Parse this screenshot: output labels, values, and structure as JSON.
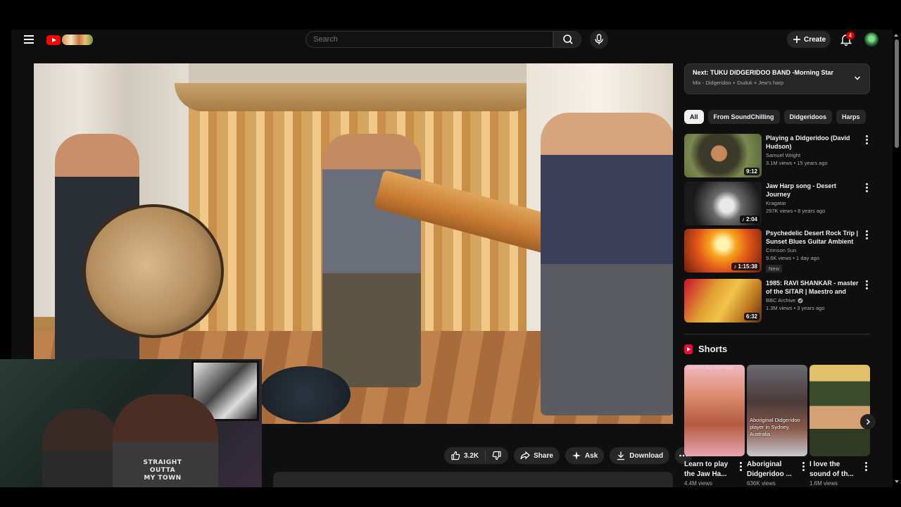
{
  "masthead": {
    "search_placeholder": "Search",
    "create_label": "Create",
    "notification_count": "4"
  },
  "player": {
    "next_title": "Next: TUKU DIDGERIDOO BAND -Morning Star",
    "next_subtitle": "Mix - Didgeridoo + Duduk + Jew's harp"
  },
  "actions": {
    "like_count": "3.2K",
    "share_label": "Share",
    "ask_label": "Ask",
    "download_label": "Download"
  },
  "webcam": {
    "shirt_lines": [
      "STRAIGHT",
      "OUTTA",
      "MY TOWN"
    ]
  },
  "chips": [
    "All",
    "From SoundChilling",
    "Didgeridoos",
    "Harps"
  ],
  "recommendations": [
    {
      "title": "Playing a Didgeridoo (David Hudson)",
      "channel": "Samuel Wright",
      "meta": "3.1M views • 15 years ago",
      "duration": "9:12",
      "verified": false,
      "new_badge": ""
    },
    {
      "title": "Jaw Harp song - Desert Journey",
      "channel": "Kragatar",
      "meta": "297K views • 8 years ago",
      "duration": "♪ 2:04",
      "verified": false,
      "new_badge": ""
    },
    {
      "title": "Psychedelic Desert Rock Trip | Sunset Blues Guitar Ambient ...",
      "channel": "Crimson Sun",
      "meta": "9.6K views • 1 day ago",
      "duration": "♪ 1:15:38",
      "verified": false,
      "new_badge": "New"
    },
    {
      "title": "1985: RAVI SHANKAR - master of the SITAR | Maestro and Gu...",
      "channel": "BBC Archive",
      "meta": "1.3M views • 3 years ago",
      "duration": "6:32",
      "verified": true,
      "new_badge": ""
    }
  ],
  "shorts": {
    "heading": "Shorts",
    "items": [
      {
        "title": "Learn to play the Jaw Ha...",
        "views": "4.4M views",
        "overlay": "",
        "top_text": "Learn to play a jaw harp"
      },
      {
        "title": "Aboriginal Didgeridoo ...",
        "views": "636K views",
        "overlay": "Aboriginal Didgeridoo player in Sydney, Australia",
        "top_text": ""
      },
      {
        "title": "I love the sound of th...",
        "views": "1.6M views",
        "overlay": "",
        "top_text": ""
      }
    ]
  },
  "colors": {
    "background": "#0f0f0f",
    "accent_red": "#ff0000",
    "chip_bg": "#272727"
  }
}
